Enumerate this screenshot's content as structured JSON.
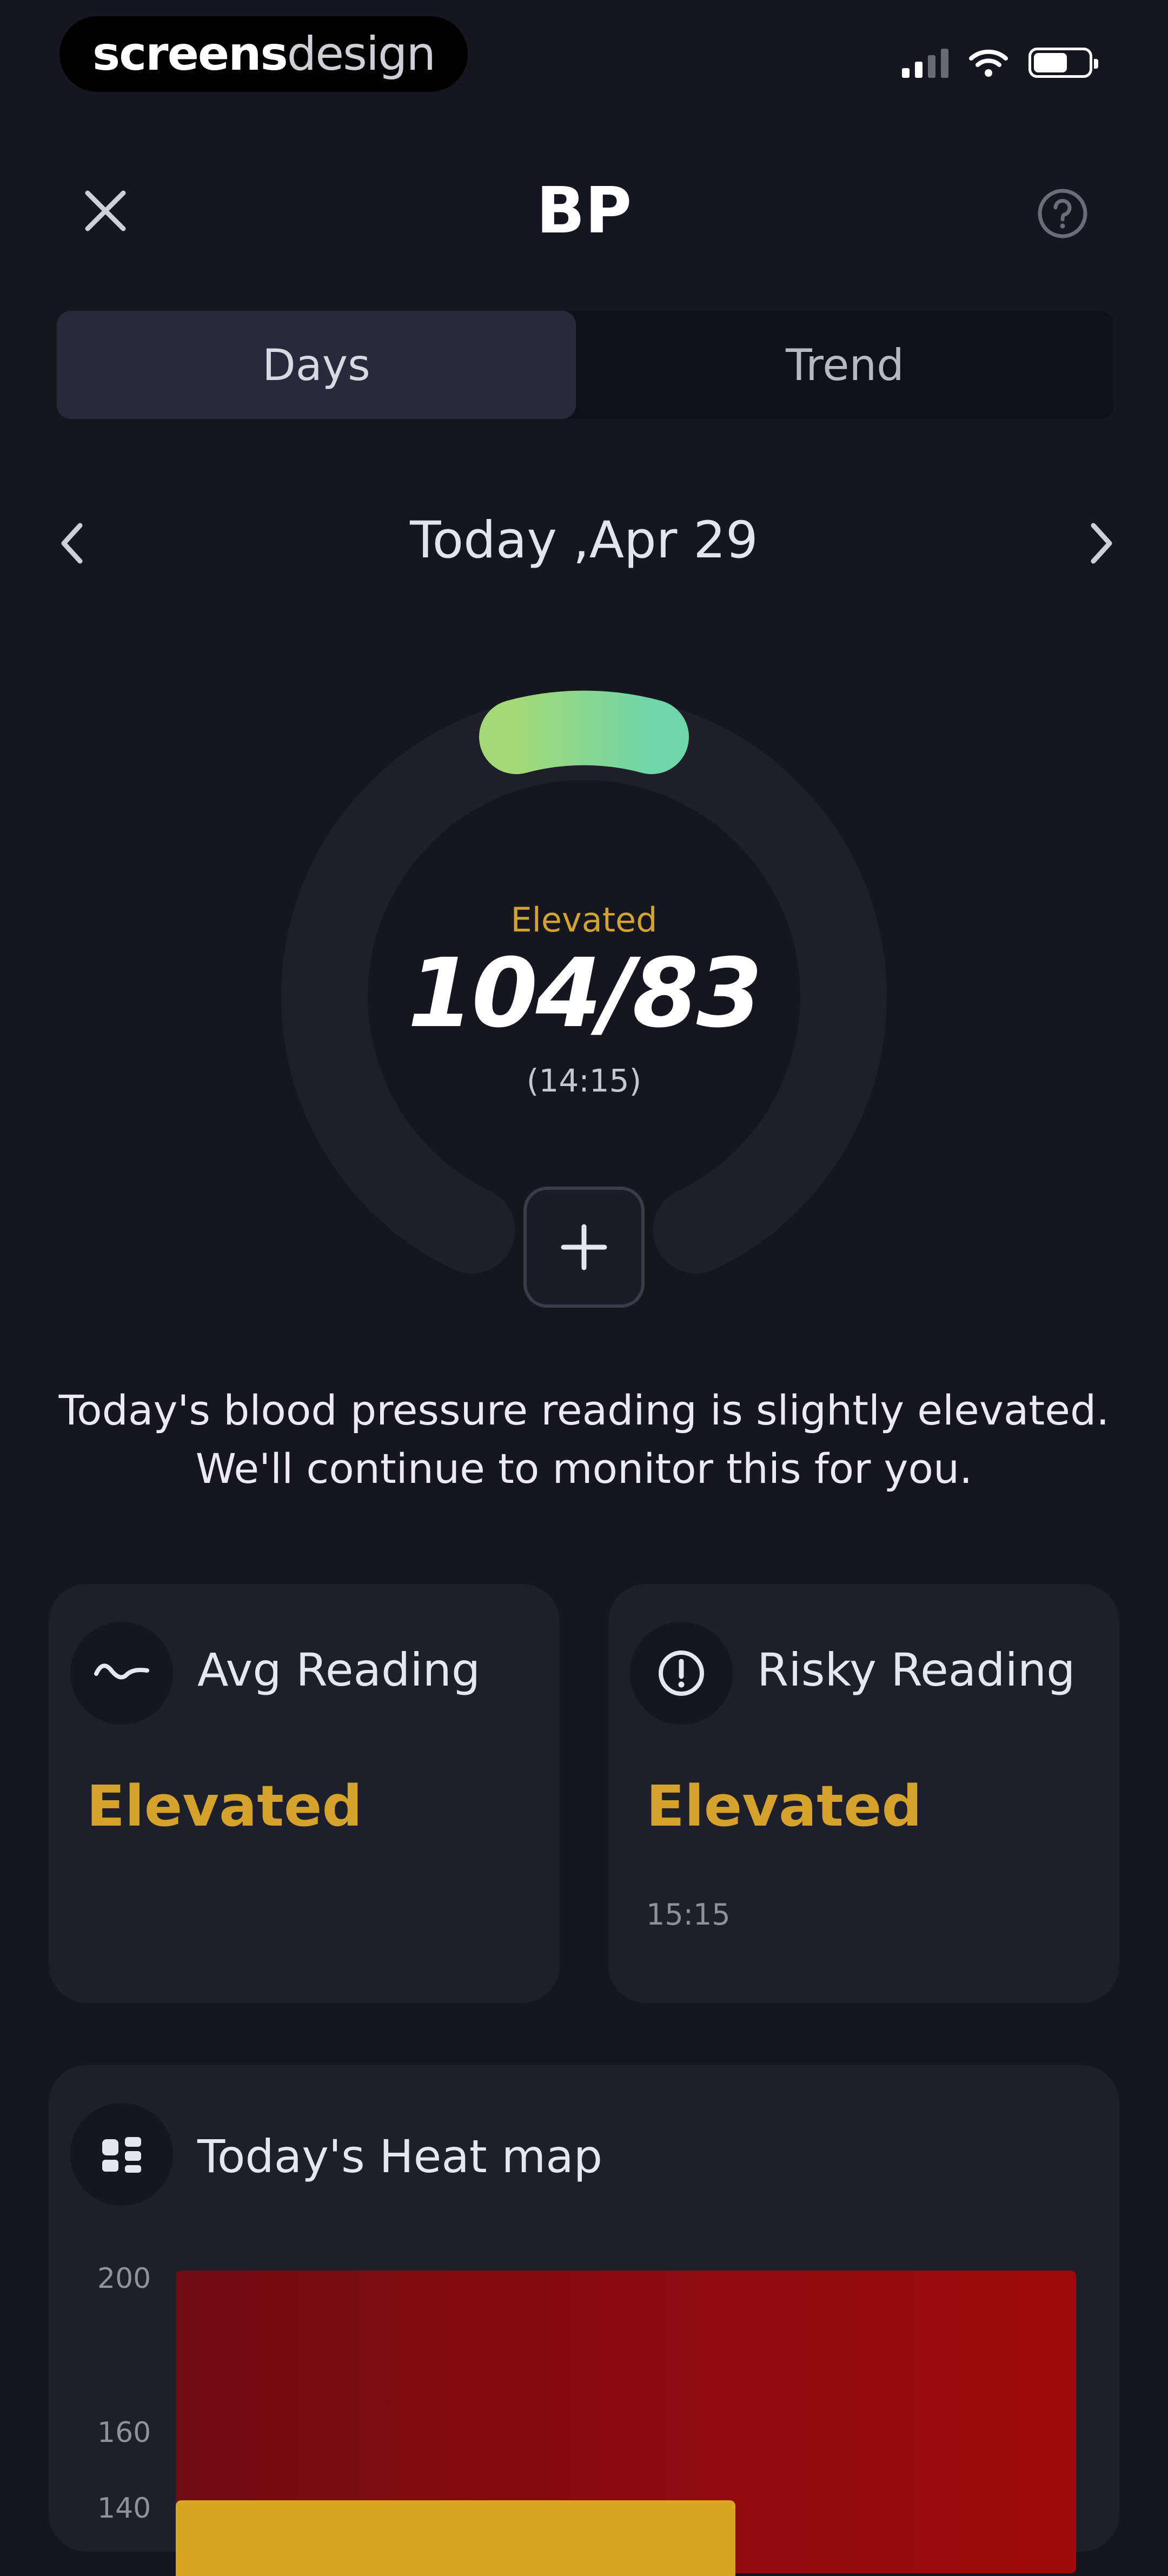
{
  "status_bar": {
    "brand_part1": "screens",
    "brand_part2": "design"
  },
  "header": {
    "title": "BP"
  },
  "tabs": [
    {
      "label": "Days",
      "selected": true
    },
    {
      "label": "Trend",
      "selected": false
    }
  ],
  "date_nav": {
    "label": "Today ,Apr 29"
  },
  "gauge": {
    "status": "Elevated",
    "reading": "104/83",
    "time": "(14:15)",
    "accent_start": "#a3d977",
    "accent_end": "#6fd6a8"
  },
  "description": {
    "line1": "Today's blood pressure reading is slightly elevated.",
    "line2": "We'll continue to monitor this for you."
  },
  "cards": {
    "avg": {
      "label": "Avg Reading",
      "value": "Elevated",
      "icon": "pulse-wave-icon"
    },
    "risky": {
      "label": "Risky Reading",
      "value": "Elevated",
      "time": "15:15",
      "icon": "alert-shield-icon"
    }
  },
  "heatmap": {
    "title": "Today's Heat map",
    "icon": "heatmap-grid-icon",
    "y_ticks": [
      "200",
      "160",
      "140"
    ]
  },
  "colors": {
    "background": "#15161e",
    "card": "#1d1f2b",
    "warning": "#d5a32b",
    "selected_tab": "#272a3b"
  }
}
